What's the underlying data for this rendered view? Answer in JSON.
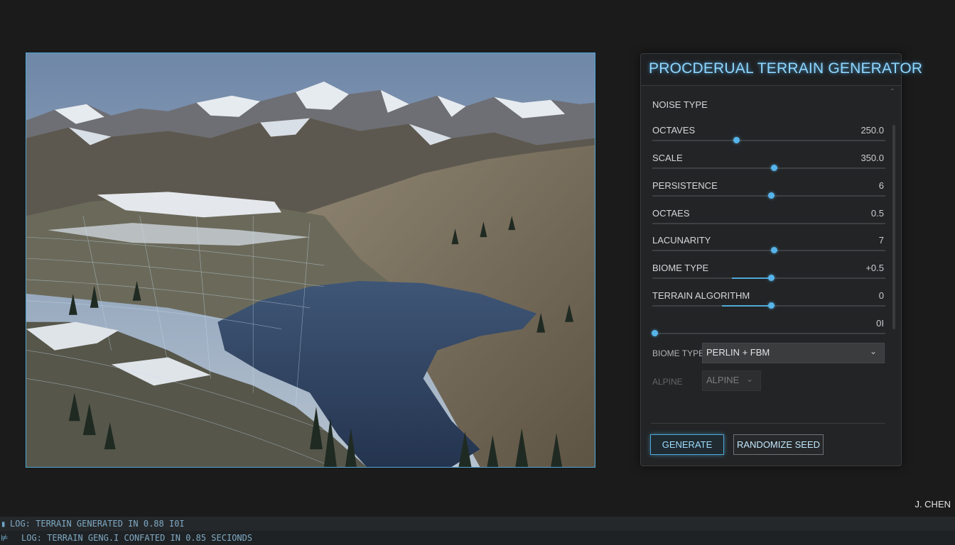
{
  "panel": {
    "title": "PROCDERUAL TERRAIN GENERATOR",
    "noise_type_label": "NOISE TYPE",
    "sliders": [
      {
        "label": "OCTAVES",
        "value": "250.0",
        "level": 0.36,
        "fill_from": null
      },
      {
        "label": "SCALE",
        "value": "350.0",
        "level": 0.52,
        "fill_from": null
      },
      {
        "label": "PERSISTENCE",
        "value": "6",
        "level": 0.51,
        "fill_from": null
      },
      {
        "label": "OCTAES",
        "value": "0.5",
        "level": null,
        "fill_from": null
      },
      {
        "label": "LACUNARITY",
        "value": "7",
        "level": 0.52,
        "fill_from": null
      },
      {
        "label": "BIOME TYPE",
        "value": "+0.5",
        "level": 0.51,
        "fill_from": 0.34
      },
      {
        "label": "TERRAIN ALGORITHM",
        "value": "0",
        "level": 0.51,
        "fill_from": 0.3
      },
      {
        "label": "",
        "value": "0I",
        "level": 0.01,
        "fill_from": null
      }
    ],
    "biome_select": {
      "label": "BIOME TYPE",
      "selected": "PERLIN + FBM"
    },
    "alpine_select": {
      "label": "ALPINE",
      "selected": "ALPINE"
    },
    "generate_label": "GENERATE",
    "randomize_label": "RANDOMIZE SEED"
  },
  "author": "J. CHEN",
  "log": {
    "line1": "LOG: TERRAIN GENERATED IN 0.88 I0I",
    "line2": "LOG: TERRAIN GENG.I CONFATED IN 0.85 SECIONDS"
  },
  "colors": {
    "accent": "#4fa8d8",
    "title_glow": "#8fd6ff",
    "panel_bg": "#232425",
    "page_bg": "#1b1b1b"
  }
}
